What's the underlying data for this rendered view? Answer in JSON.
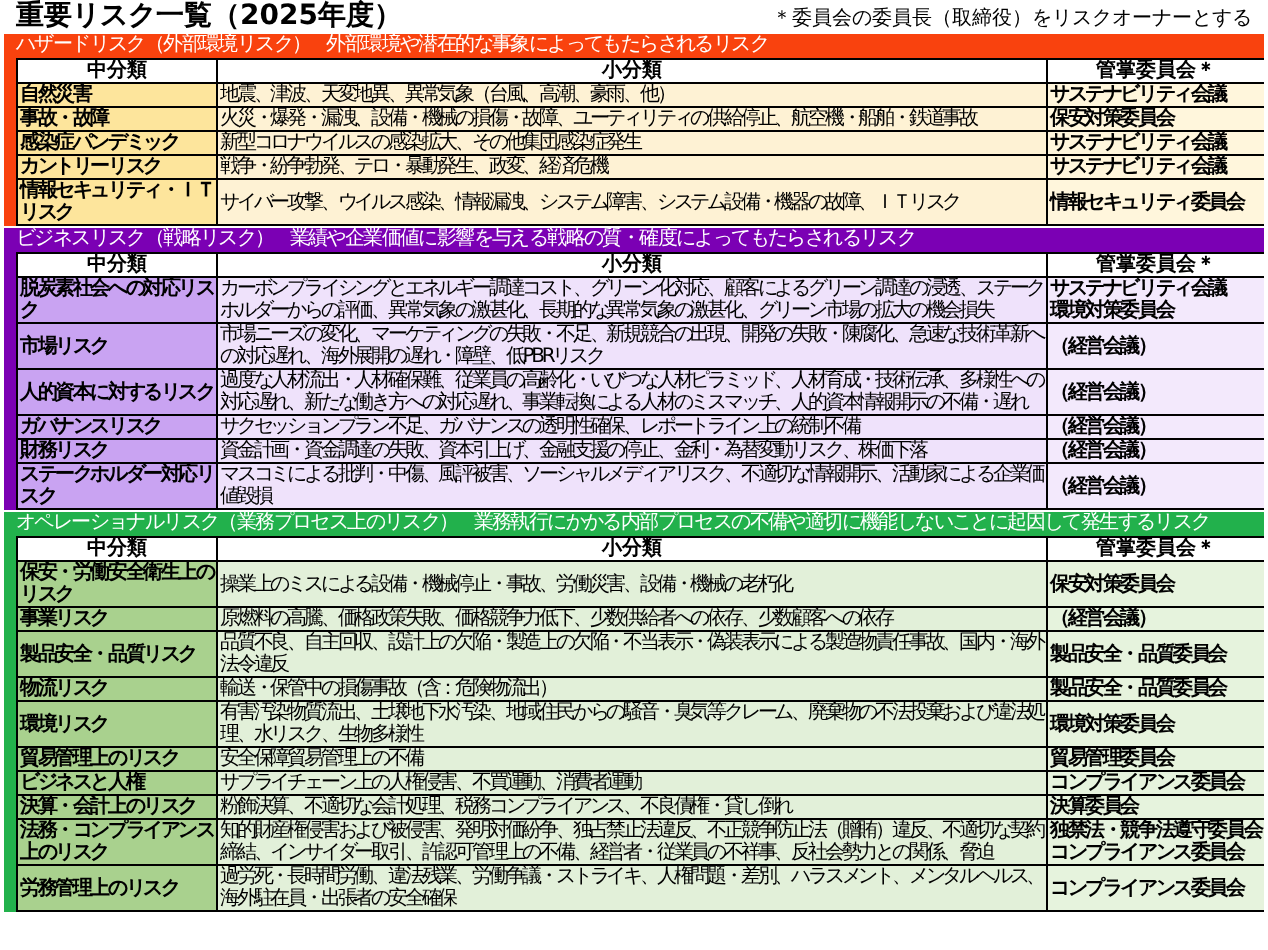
{
  "title": "重要リスク一覧（2025年度）",
  "note": "＊委員会の委員長（取締役）をリスクオーナーとする",
  "sections": [
    {
      "kind": "hazard",
      "color": "#f9420e",
      "title": "ハザードリスク（外部環境リスク）",
      "description": "外部環境や潜在的な事象によってもたらされるリスク",
      "columns": [
        "中分類",
        "小分類",
        "管掌委員会＊"
      ],
      "rows": [
        {
          "category": "自然災害",
          "detail": "地震、津波、天変地異、異常気象（台風、高潮、豪雨、他）",
          "owners": [
            "サステナビリティ会議"
          ]
        },
        {
          "category": "事故・故障",
          "detail": "火災・爆発・漏洩、設備・機械の損傷・故障、ユーティリティの供給停止、航空機・船舶・鉄道事故",
          "owners": [
            "保安対策委員会"
          ]
        },
        {
          "category": "感染症パンデミック",
          "detail": "新型コロナウイルスの感染拡大、その他集団感染症発生",
          "owners": [
            "サステナビリティ会議"
          ]
        },
        {
          "category": "カントリーリスク",
          "detail": "戦争・紛争勃発、テロ・暴動発生、政変、経済危機",
          "owners": [
            "サステナビリティ会議"
          ]
        },
        {
          "category": "情報セキュリティ・ＩＴリスク",
          "detail": "サイバー攻撃、ウイルス感染、情報漏洩、システム障害、システム設備・機器の故障、ＩＴリスク",
          "owners": [
            "情報セキュリティ委員会"
          ]
        }
      ]
    },
    {
      "kind": "business",
      "color": "#7b00b4",
      "title": "ビジネスリスク（戦略リスク）",
      "description": "業績や企業価値に影響を与える戦略の質・確度によってもたらされるリスク",
      "columns": [
        "中分類",
        "小分類",
        "管掌委員会＊"
      ],
      "rows": [
        {
          "category": "脱炭素社会への対応リスク",
          "detail": "カーボンプライシングとエネルギー調達コスト、グリーン化対応、顧客によるグリーン調達の浸透、ステークホルダーからの評価、異常気象の激甚化、長期的な異常気象の激甚化、グリーン市場の拡大の機会損失",
          "owners": [
            "サステナビリティ会議",
            "環境対策委員会"
          ]
        },
        {
          "category": "市場リスク",
          "detail": "市場ニーズの変化、マーケティングの失敗・不足、新規競合の出現、開発の失敗・陳腐化、急速な技術革新への対応遅れ、海外展開の遅れ・障壁、低PBRリスク",
          "owners": [
            "（経営会議）"
          ]
        },
        {
          "category": "人的資本に対するリスク",
          "detail": "過度な人材流出・人材確保難、従業員の高齢化・いびつな人材ピラミッド、人材育成・技術伝承、多様性への対応遅れ、新たな働き方への対応遅れ、事業転換による人材のミスマッチ、人的資本情報開示の不備・遅れ",
          "owners": [
            "（経営会議）"
          ]
        },
        {
          "category": "ガバナンスリスク",
          "detail": "サクセッションプラン不足、ガバナンスの透明性確保、レポートライン上の統制不備",
          "owners": [
            "（経営会議）"
          ]
        },
        {
          "category": "財務リスク",
          "detail": "資金計画・資金調達の失敗、資本引上げ、金融支援の停止、金利・為替変動リスク、株価下落",
          "owners": [
            "（経営会議）"
          ]
        },
        {
          "category": "ステークホルダー対応リスク",
          "detail": "マスコミによる批判・中傷、風評被害、ソーシャルメディアリスク、不適切な情報開示、活動家による企業価値毀損",
          "owners": [
            "（経営会議）"
          ]
        }
      ]
    },
    {
      "kind": "operational",
      "color": "#22b14c",
      "title": "オペレーショナルリスク（業務プロセス上のリスク）",
      "description": "業務執行にかかる内部プロセスの不備や適切に機能しないことに起因して発生するリスク",
      "columns": [
        "中分類",
        "小分類",
        "管掌委員会＊"
      ],
      "rows": [
        {
          "category": "保安・労働安全衛生上のリスク",
          "detail": "操業上のミスによる設備・機械停止・事故、労働災害、設備・機械の老朽化",
          "owners": [
            "保安対策委員会"
          ]
        },
        {
          "category": "事業リスク",
          "detail": "原燃料の高騰、価格政策失敗、価格競争力低下、少数供給者への依存、少数顧客への依存",
          "owners": [
            "（経営会議）"
          ]
        },
        {
          "category": "製品安全・品質リスク",
          "detail": "品質不良、自主回収、設計上の欠陥・製造上の欠陥・不当表示・偽装表示による製造物責任事故、国内・海外法令違反",
          "owners": [
            "製品安全・品質委員会"
          ]
        },
        {
          "category": "物流リスク",
          "detail": "輸送・保管中の損傷事故（含：危険物流出）",
          "owners": [
            "製品安全・品質委員会"
          ]
        },
        {
          "category": "環境リスク",
          "detail": "有害汚染物質流出、土壌地下水汚染、地域住民からの騒音・臭気等クレーム、廃棄物の不法投棄および違法処理、水リスク、生物多様性",
          "owners": [
            "環境対策委員会"
          ]
        },
        {
          "category": "貿易管理上のリスク",
          "detail": "安全保障貿易管理上の不備",
          "owners": [
            "貿易管理委員会"
          ]
        },
        {
          "category": "ビジネスと人権",
          "detail": "サプライチェーン上の人権侵害、不買運動、消費者運動",
          "owners": [
            "コンプライアンス委員会"
          ]
        },
        {
          "category": "決算・会計上のリスク",
          "detail": "粉飾決算、不適切な会計処理、税務コンプライアンス、不良債権・貸し倒れ",
          "owners": [
            "決算委員会"
          ]
        },
        {
          "category": "法務・コンプライアンス上のリスク",
          "detail": "知的財産権侵害および被侵害、発明対価紛争、独占禁止法違反、不正競争防止法（贈賄）違反、不適切な契約締結、インサイダー取引、許認可管理上の不備、経営者・従業員の不祥事、反社会勢力との関係、脅迫",
          "owners": [
            "独禁法・競争法遵守委員会",
            "コンプライアンス委員会"
          ]
        },
        {
          "category": "労務管理上のリスク",
          "detail": "過労死・長時間労働、違法残業、労働争議・ストライキ、人権問題・差別、ハラスメント、メンタルヘルス、海外駐在員・出張者の安全確保",
          "owners": [
            "コンプライアンス委員会"
          ]
        }
      ]
    }
  ]
}
